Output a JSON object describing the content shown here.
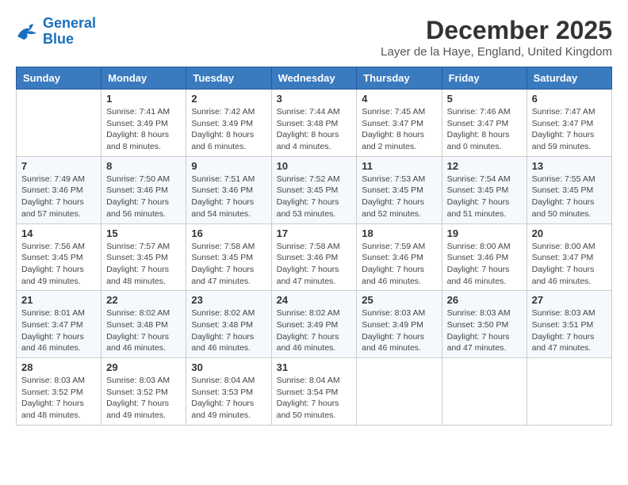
{
  "logo": {
    "line1": "General",
    "line2": "Blue"
  },
  "title": "December 2025",
  "location": "Layer de la Haye, England, United Kingdom",
  "weekdays": [
    "Sunday",
    "Monday",
    "Tuesday",
    "Wednesday",
    "Thursday",
    "Friday",
    "Saturday"
  ],
  "weeks": [
    [
      {
        "day": "",
        "info": ""
      },
      {
        "day": "1",
        "info": "Sunrise: 7:41 AM\nSunset: 3:49 PM\nDaylight: 8 hours\nand 8 minutes."
      },
      {
        "day": "2",
        "info": "Sunrise: 7:42 AM\nSunset: 3:49 PM\nDaylight: 8 hours\nand 6 minutes."
      },
      {
        "day": "3",
        "info": "Sunrise: 7:44 AM\nSunset: 3:48 PM\nDaylight: 8 hours\nand 4 minutes."
      },
      {
        "day": "4",
        "info": "Sunrise: 7:45 AM\nSunset: 3:47 PM\nDaylight: 8 hours\nand 2 minutes."
      },
      {
        "day": "5",
        "info": "Sunrise: 7:46 AM\nSunset: 3:47 PM\nDaylight: 8 hours\nand 0 minutes."
      },
      {
        "day": "6",
        "info": "Sunrise: 7:47 AM\nSunset: 3:47 PM\nDaylight: 7 hours\nand 59 minutes."
      }
    ],
    [
      {
        "day": "7",
        "info": "Sunrise: 7:49 AM\nSunset: 3:46 PM\nDaylight: 7 hours\nand 57 minutes."
      },
      {
        "day": "8",
        "info": "Sunrise: 7:50 AM\nSunset: 3:46 PM\nDaylight: 7 hours\nand 56 minutes."
      },
      {
        "day": "9",
        "info": "Sunrise: 7:51 AM\nSunset: 3:46 PM\nDaylight: 7 hours\nand 54 minutes."
      },
      {
        "day": "10",
        "info": "Sunrise: 7:52 AM\nSunset: 3:45 PM\nDaylight: 7 hours\nand 53 minutes."
      },
      {
        "day": "11",
        "info": "Sunrise: 7:53 AM\nSunset: 3:45 PM\nDaylight: 7 hours\nand 52 minutes."
      },
      {
        "day": "12",
        "info": "Sunrise: 7:54 AM\nSunset: 3:45 PM\nDaylight: 7 hours\nand 51 minutes."
      },
      {
        "day": "13",
        "info": "Sunrise: 7:55 AM\nSunset: 3:45 PM\nDaylight: 7 hours\nand 50 minutes."
      }
    ],
    [
      {
        "day": "14",
        "info": "Sunrise: 7:56 AM\nSunset: 3:45 PM\nDaylight: 7 hours\nand 49 minutes."
      },
      {
        "day": "15",
        "info": "Sunrise: 7:57 AM\nSunset: 3:45 PM\nDaylight: 7 hours\nand 48 minutes."
      },
      {
        "day": "16",
        "info": "Sunrise: 7:58 AM\nSunset: 3:45 PM\nDaylight: 7 hours\nand 47 minutes."
      },
      {
        "day": "17",
        "info": "Sunrise: 7:58 AM\nSunset: 3:46 PM\nDaylight: 7 hours\nand 47 minutes."
      },
      {
        "day": "18",
        "info": "Sunrise: 7:59 AM\nSunset: 3:46 PM\nDaylight: 7 hours\nand 46 minutes."
      },
      {
        "day": "19",
        "info": "Sunrise: 8:00 AM\nSunset: 3:46 PM\nDaylight: 7 hours\nand 46 minutes."
      },
      {
        "day": "20",
        "info": "Sunrise: 8:00 AM\nSunset: 3:47 PM\nDaylight: 7 hours\nand 46 minutes."
      }
    ],
    [
      {
        "day": "21",
        "info": "Sunrise: 8:01 AM\nSunset: 3:47 PM\nDaylight: 7 hours\nand 46 minutes."
      },
      {
        "day": "22",
        "info": "Sunrise: 8:02 AM\nSunset: 3:48 PM\nDaylight: 7 hours\nand 46 minutes."
      },
      {
        "day": "23",
        "info": "Sunrise: 8:02 AM\nSunset: 3:48 PM\nDaylight: 7 hours\nand 46 minutes."
      },
      {
        "day": "24",
        "info": "Sunrise: 8:02 AM\nSunset: 3:49 PM\nDaylight: 7 hours\nand 46 minutes."
      },
      {
        "day": "25",
        "info": "Sunrise: 8:03 AM\nSunset: 3:49 PM\nDaylight: 7 hours\nand 46 minutes."
      },
      {
        "day": "26",
        "info": "Sunrise: 8:03 AM\nSunset: 3:50 PM\nDaylight: 7 hours\nand 47 minutes."
      },
      {
        "day": "27",
        "info": "Sunrise: 8:03 AM\nSunset: 3:51 PM\nDaylight: 7 hours\nand 47 minutes."
      }
    ],
    [
      {
        "day": "28",
        "info": "Sunrise: 8:03 AM\nSunset: 3:52 PM\nDaylight: 7 hours\nand 48 minutes."
      },
      {
        "day": "29",
        "info": "Sunrise: 8:03 AM\nSunset: 3:52 PM\nDaylight: 7 hours\nand 49 minutes."
      },
      {
        "day": "30",
        "info": "Sunrise: 8:04 AM\nSunset: 3:53 PM\nDaylight: 7 hours\nand 49 minutes."
      },
      {
        "day": "31",
        "info": "Sunrise: 8:04 AM\nSunset: 3:54 PM\nDaylight: 7 hours\nand 50 minutes."
      },
      {
        "day": "",
        "info": ""
      },
      {
        "day": "",
        "info": ""
      },
      {
        "day": "",
        "info": ""
      }
    ]
  ]
}
